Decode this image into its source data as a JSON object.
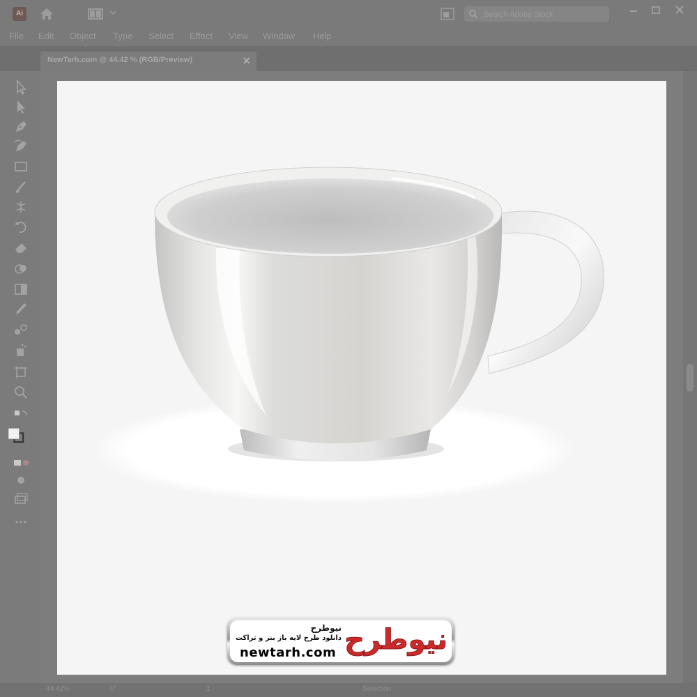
{
  "app": {
    "logo_text": "Ai",
    "search_placeholder": "Search Adobe Stock"
  },
  "menu": {
    "items": [
      "File",
      "Edit",
      "Object",
      "Type",
      "Select",
      "Effect",
      "View",
      "Window",
      "Help"
    ]
  },
  "document": {
    "tab_label": "NewTarh.com @ 44.42 % (RGB/Preview)",
    "close_symbol": "✕"
  },
  "tools": [
    "selection-tool",
    "direct-selection-tool",
    "pen-tool",
    "curvature-tool",
    "rectangle-tool",
    "paintbrush-tool",
    "width-tool",
    "rotate-tool",
    "eraser-tool",
    "shape-builder-tool",
    "gradient-tool",
    "eyedropper-tool",
    "blend-tool",
    "symbol-sprayer-tool",
    "artboard-tool",
    "zoom-tool"
  ],
  "colors": {
    "fill": "#f2f2f2",
    "stroke": "#333333",
    "accent_red": "#cc2a2a"
  },
  "watermark": {
    "title": "نیوطرح",
    "subtitle": "دانلود طرح لایه باز بنر و تراکت",
    "url": "newtarh.com",
    "logo_text": "نیوطرح"
  },
  "status": {
    "zoom": "44.42%",
    "rotation": "0°",
    "artboard_number": "1",
    "tool_name": "Selection"
  }
}
